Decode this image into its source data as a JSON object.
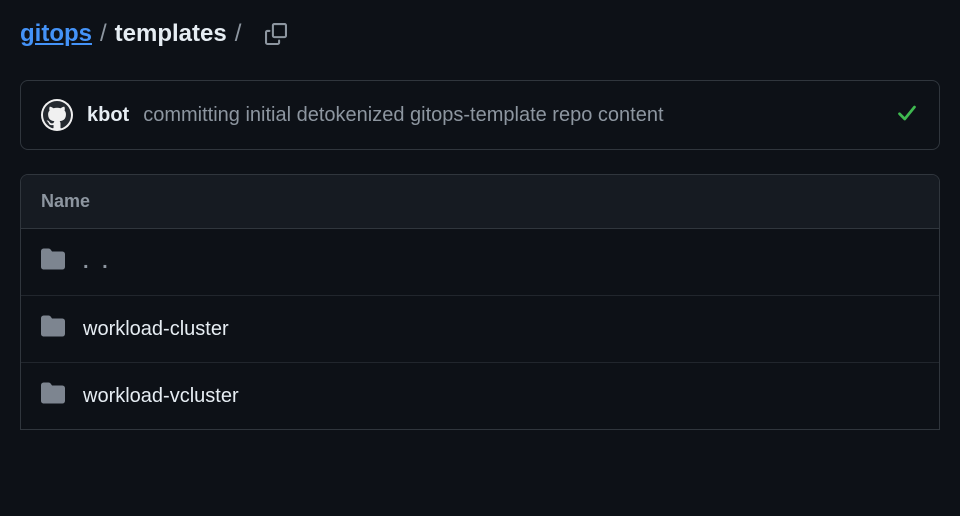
{
  "breadcrumb": {
    "repo": "gitops",
    "folder": "templates",
    "separator": "/"
  },
  "commit": {
    "author": "kbot",
    "message": "committing initial detokenized gitops-template repo content"
  },
  "table": {
    "header": "Name",
    "parent": ". .",
    "rows": [
      {
        "name": "workload-cluster"
      },
      {
        "name": "workload-vcluster"
      }
    ]
  }
}
